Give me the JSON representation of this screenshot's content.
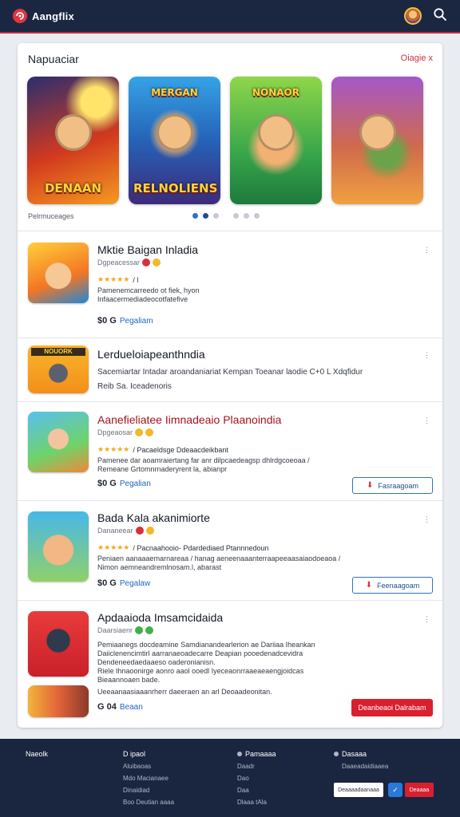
{
  "header": {
    "app_name": "Aangflix",
    "icons": [
      "logo-icon",
      "avatar",
      "search-icon"
    ]
  },
  "featured": {
    "title": "Napuaciar",
    "close_label": "Oiagie x",
    "subtitle": "Pelrmuceages",
    "tiles": [
      {
        "top_word": "",
        "bottom_word": "DENAAN"
      },
      {
        "top_word": "MERGAN",
        "bottom_word": "RELNOLIENS"
      },
      {
        "top_word": "NONAOR",
        "bottom_word": ""
      },
      {
        "top_word": "",
        "bottom_word": ""
      }
    ],
    "pager": {
      "count": 6,
      "active_index": 1
    }
  },
  "items": [
    {
      "title": "Mktie Baigan Inladia",
      "developer": "Dgpeacessar",
      "rating_text": "/ l",
      "desc": [
        "Pamenemcarreedo ot fiek, hyon",
        "Infaacermediadeocotfatefive"
      ],
      "price": "$0 G",
      "price_link": "Pegaliam",
      "menu": "⋮"
    },
    {
      "title": "Lerdueloiapeanthndia",
      "desc": [
        "Sacemiartar Intadar aroandaniariat Kempan Toeanar laodie C+0 L Xdqfidur",
        "Reib Sa. Iceadenoris"
      ],
      "menu": "⋮"
    },
    {
      "title": "Aanefieliatee Iimnadeaio Plaanoindia",
      "developer": "Dpgeaosar",
      "rating_text": "/ Pacaeldsge Ddeaacdeikbant",
      "desc": [
        "Pamenee dar aoamraiertang far anr dilpcaedeagsp dhlrdgcoeoaa /",
        "Remeane Grtomnrnaderyrent la, abianpr"
      ],
      "price": "$0 G",
      "price_link": "Pegalian",
      "button": "Fasraagoam",
      "menu": "⋮"
    },
    {
      "title": "Bada Kala akanimiorte",
      "developer": "Dananeear",
      "rating_text": "/ Pacnaahooio- Pdardediaed Ptannnedoun",
      "desc": [
        "Peniaen aanaaaemarnareaa / hanag aeneenaaanterraapeeaasaiaodoeaoa /",
        "Nimon aemneandremlnosam.l, abarast"
      ],
      "price": "$0 G",
      "price_link": "Pegalaw",
      "button": "Feenaagoam",
      "menu": "⋮"
    },
    {
      "title": "Apdaaioda Imsamcidaida",
      "developer": "Daarsiaenr",
      "desc": [
        "Pemiaanegs docdeamine Samdianandearlerion ae Dariiaa Iheankan",
        "Daiiclenencimtirl aarranaeoadecarre Deapian pooedenadcevidra",
        "Dendeneedaedaaeso oaderonianisn.",
        "Riele Ihnaoonirge aonro aaol ooedl Iyeceaonrraaeaeaengjoidcas",
        "Bieaannoaen bade.",
        "Ueeaanaasiaaanrherr daeeraen an arl Deoaadeonitan."
      ],
      "price": "G 04",
      "price_link": "Beaan",
      "button": "Deanbeaoi Dalrabam",
      "menu": "⋮"
    }
  ],
  "footer": {
    "col1": {
      "head": "Naeolk"
    },
    "col2": {
      "head": "D ipaol",
      "links": [
        "Aluibaoas",
        "Mdo Macianaee",
        "Dinaidiad",
        "Boo Deutian aaaa"
      ]
    },
    "col3": {
      "head": "Pamaaaa",
      "links": [
        "Daadr",
        "Dao",
        "Daa",
        "Dlaaa tAla"
      ]
    },
    "col4": {
      "head": "Dasaaa",
      "links": [
        "Daaeadaidiaaea"
      ]
    },
    "btn_white": "Deaaaadaanaaa",
    "btn_red": "Deaaaa"
  },
  "colors": {
    "header_bg": "#1b2741",
    "accent_red": "#d9202e",
    "link_blue": "#1e66c2",
    "star": "#f2a81c"
  }
}
